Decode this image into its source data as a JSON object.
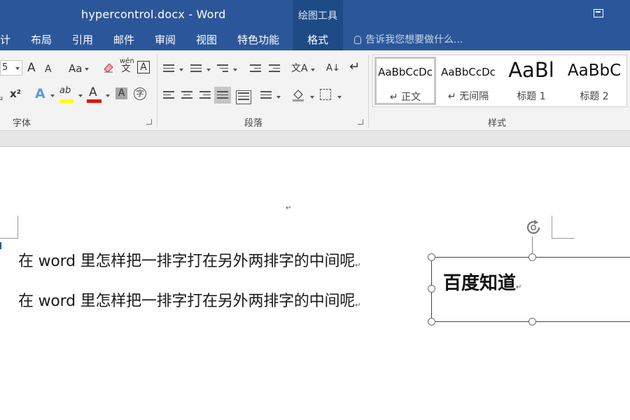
{
  "app": {
    "title": "hypercontrol.docx - Word",
    "context_group": "绘图工具",
    "colors": {
      "titlebar": "#2b579a",
      "accent_red": "#e51400",
      "highlight_yellow": "#ffff00"
    }
  },
  "tabs": [
    {
      "label": "计"
    },
    {
      "label": "布局"
    },
    {
      "label": "引用"
    },
    {
      "label": "邮件"
    },
    {
      "label": "审阅"
    },
    {
      "label": "视图"
    },
    {
      "label": "特色功能"
    },
    {
      "label": "格式",
      "active": true
    }
  ],
  "tell_me": {
    "placeholder": "告诉我您想要做什么..."
  },
  "ribbon": {
    "font": {
      "label": "字体",
      "size_value": "5",
      "grow_label": "A",
      "shrink_label": "A",
      "case_label": "Aa",
      "phonetic_top": "wén",
      "phonetic_bottom": "文",
      "border_char_label": "A",
      "superscript_label": "x²",
      "subscript_label": "₂",
      "effects_label": "A",
      "highlight_label": "ab",
      "font_color_label": "A",
      "shading_label": "A",
      "enclose_label": "字"
    },
    "paragraph": {
      "label": "段落",
      "sort_label": "A↓",
      "zh_label": "文A"
    },
    "styles": {
      "label": "样式",
      "items": [
        {
          "sample": "AaBbCcDc",
          "name": "↵ 正文"
        },
        {
          "sample": "AaBbCcDc",
          "name": "↵ 无间隔"
        },
        {
          "sample": "AaBl",
          "name": "标题 1"
        },
        {
          "sample": "AaBbC",
          "name": "标题 2"
        }
      ]
    }
  },
  "document": {
    "empty_para_mark": "↵",
    "lines": [
      "在 word 里怎样把一排字打在另外两排字的中间呢",
      "在 word 里怎样把一排字打在另外两排字的中间呢"
    ],
    "line_marks": [
      "↵",
      "↵"
    ],
    "textbox": {
      "text": "百度知道",
      "mark": "↵"
    }
  },
  "icons": [
    "restore-icon",
    "lightbulb-icon",
    "rotate-handle-icon"
  ]
}
